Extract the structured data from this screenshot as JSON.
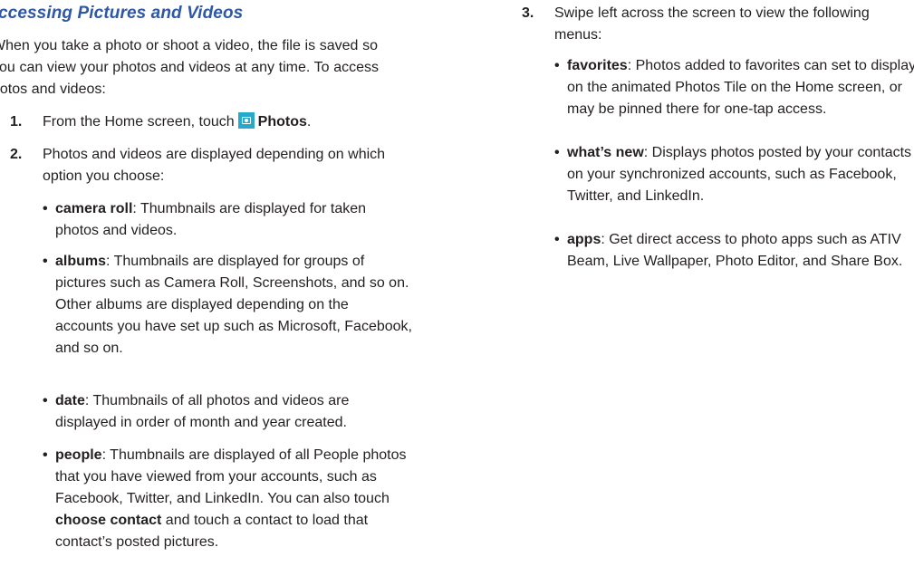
{
  "heading": "ccessing Pictures and Videos",
  "intro": [
    "When you take a photo or shoot a video, the file is saved so",
    "you can view your photos and videos at any time. To access",
    "hotos and videos:"
  ],
  "steps": {
    "step1": {
      "num": "1.",
      "before": "From the Home screen, touch",
      "app": "Photos",
      "after": "."
    },
    "step2": {
      "num": "2.",
      "lines": [
        "Photos and videos are displayed depending on which",
        "option you choose:"
      ]
    },
    "step3": {
      "num": "3.",
      "lines": [
        "Swipe left across the screen to view the following",
        "menus:"
      ]
    }
  },
  "options": {
    "camera_roll": {
      "term": "camera roll",
      "lines": [
        ": Thumbnails are displayed for taken",
        "photos and videos."
      ]
    },
    "albums": {
      "term": "albums",
      "lines": [
        ": Thumbnails are displayed for groups of",
        "pictures such as Camera Roll, Screenshots, and so on.",
        "Other albums are displayed depending on the",
        "accounts you have set up such as Microsoft, Facebook,",
        "and so on."
      ]
    },
    "date": {
      "term": "date",
      "lines": [
        ": Thumbnails of all photos and videos are",
        "displayed in order of month and year created."
      ]
    },
    "people": {
      "term": "people",
      "lines": [
        ": Thumbnails are displayed of all People photos",
        "that you have viewed from your accounts, such as",
        "Facebook, Twitter, and LinkedIn. You can also touch"
      ],
      "term2": "choose contact",
      "after2": " and touch a contact to load that",
      "last": "contact’s posted pictures."
    }
  },
  "menus": {
    "favorites": {
      "term": "favorites",
      "lines": [
        ": Photos added to favorites can set to display",
        "on the animated Photos Tile on the Home screen, or",
        "may be pinned there for one-tap access."
      ]
    },
    "whats_new": {
      "term": "what’s new",
      "lines": [
        ": Displays photos posted by your contacts",
        "on your synchronized accounts, such as Facebook,",
        "Twitter, and LinkedIn."
      ]
    },
    "apps": {
      "term": "apps",
      "lines": [
        ": Get direct access to photo apps such as ATIV",
        "Beam, Live Wallpaper, Photo Editor, and Share Box."
      ]
    }
  },
  "bullet": "•"
}
